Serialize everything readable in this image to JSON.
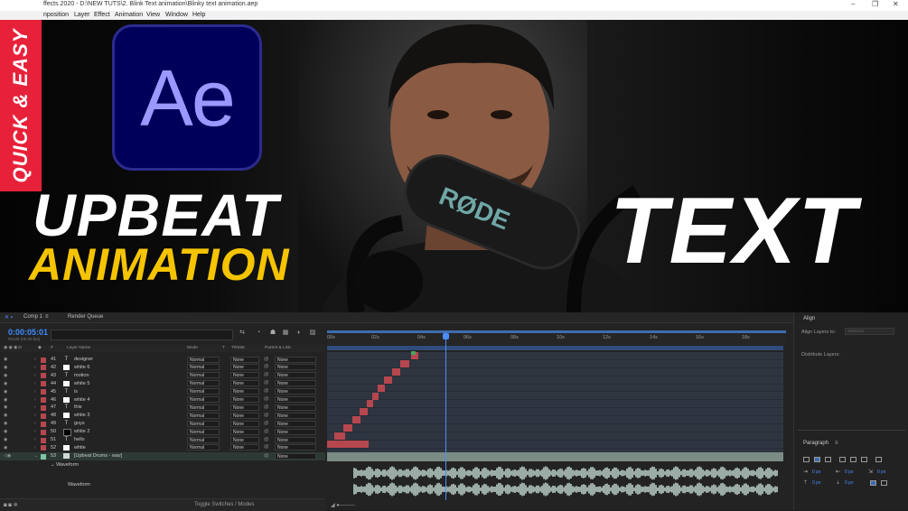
{
  "window": {
    "title": "ffects 2020 - D:\\NEW TUTS\\2. Blink Text animation\\Blinky text animation.aep"
  },
  "menu": [
    "nposition",
    "Layer",
    "Effect",
    "Animation",
    "View",
    "Window",
    "Help"
  ],
  "thumbnail": {
    "badge": "QUICK & EASY",
    "logo": "Ae",
    "line1": "UPBEAT",
    "line2": "ANIMATION",
    "line3": "TEXT",
    "colors": {
      "badge": "#e8213a",
      "yellow": "#f5c400",
      "logo_bg": "#00005b",
      "logo_text": "#9999ff"
    }
  },
  "panels": {
    "comp_tab": "Comp 1",
    "render_queue_tab": "Render Queue",
    "align_tab": "Align",
    "paragraph_tab": "Paragraph"
  },
  "timeline": {
    "timecode": "0:00:05:01",
    "fps": "00125 (25.00 fps)",
    "columns": {
      "layer_name": "Layer Name",
      "mode": "Mode",
      "t": "T",
      "trkmat": "TrkMat",
      "parent": "Parent & Link"
    },
    "ruler": [
      "00s",
      "02s",
      "04s",
      "06s",
      "08s",
      "10s",
      "12s",
      "14s",
      "16s",
      "18s"
    ],
    "layers": [
      {
        "num": "41",
        "type": "T",
        "name": "designer",
        "mode": "Normal",
        "trkmat": "None",
        "parent": "None",
        "color": "#b6474f"
      },
      {
        "num": "42",
        "type": "solid",
        "name": "white 6",
        "mode": "Normal",
        "trkmat": "None",
        "parent": "None",
        "color": "#b6474f"
      },
      {
        "num": "43",
        "type": "T",
        "name": "motion",
        "mode": "Normal",
        "trkmat": "None",
        "parent": "None",
        "color": "#b6474f"
      },
      {
        "num": "44",
        "type": "solid",
        "name": "white 5",
        "mode": "Normal",
        "trkmat": "None",
        "parent": "None",
        "color": "#b6474f"
      },
      {
        "num": "45",
        "type": "T",
        "name": "is",
        "mode": "Normal",
        "trkmat": "None",
        "parent": "None",
        "color": "#b6474f"
      },
      {
        "num": "46",
        "type": "solid",
        "name": "white 4",
        "mode": "Normal",
        "trkmat": "None",
        "parent": "None",
        "color": "#b6474f"
      },
      {
        "num": "47",
        "type": "T",
        "name": "this",
        "mode": "Normal",
        "trkmat": "None",
        "parent": "None",
        "color": "#b6474f"
      },
      {
        "num": "48",
        "type": "solid",
        "name": "white 3",
        "mode": "Normal",
        "trkmat": "None",
        "parent": "None",
        "color": "#b6474f"
      },
      {
        "num": "49",
        "type": "T",
        "name": "guys",
        "mode": "Normal",
        "trkmat": "None",
        "parent": "None",
        "color": "#b6474f"
      },
      {
        "num": "50",
        "type": "solid-dark",
        "name": "white 2",
        "mode": "Normal",
        "trkmat": "None",
        "parent": "None",
        "color": "#b6474f"
      },
      {
        "num": "51",
        "type": "T",
        "name": "hello",
        "mode": "Normal",
        "trkmat": "None",
        "parent": "None",
        "color": "#b6474f"
      },
      {
        "num": "52",
        "type": "solid",
        "name": "white",
        "mode": "Normal",
        "trkmat": "None",
        "parent": "None",
        "color": "#b6474f"
      }
    ],
    "audio_layer": {
      "num": "53",
      "name": "[Upbeat Drums - wav]",
      "parent": "None",
      "color": "#7fc6a4"
    },
    "waveform_group": "Waveform",
    "waveform_label": "Waveform",
    "toggle": "Toggle Switches / Modes"
  },
  "align": {
    "align_layers_to": "Align Layers to:",
    "selection": "Selection",
    "distribute": "Distribute Layers:"
  },
  "paragraph": {
    "values": [
      "0 px",
      "0 px",
      "0 px",
      "0 px",
      "0 px"
    ]
  }
}
